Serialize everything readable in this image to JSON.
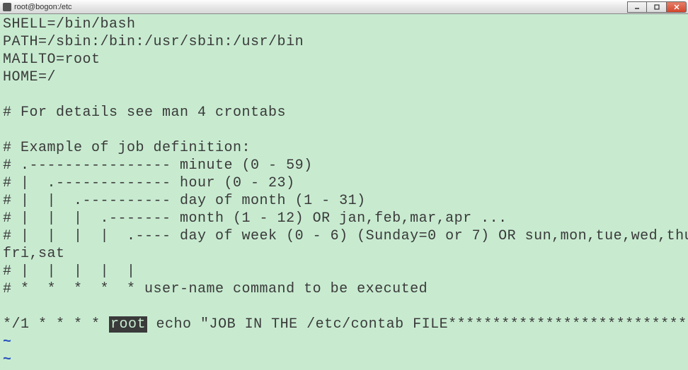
{
  "window": {
    "title": "root@bogon:/etc"
  },
  "terminal": {
    "lines": {
      "l0": "SHELL=/bin/bash",
      "l1": "PATH=/sbin:/bin:/usr/sbin:/usr/bin",
      "l2": "MAILTO=root",
      "l3": "HOME=/",
      "l4": "",
      "l5": "# For details see man 4 crontabs",
      "l6": "",
      "l7": "# Example of job definition:",
      "l8": "# .---------------- minute (0 - 59)",
      "l9": "# |  .------------- hour (0 - 23)",
      "l10": "# |  |  .---------- day of month (1 - 31)",
      "l11": "# |  |  |  .------- month (1 - 12) OR jan,feb,mar,apr ...",
      "l12": "# |  |  |  |  .---- day of week (0 - 6) (Sunday=0 or 7) OR sun,mon,tue,wed,thu,",
      "l13": "fri,sat",
      "l14": "# |  |  |  |  |",
      "l15": "# *  *  *  *  * user-name command to be executed",
      "l16": "",
      "l17_pre": "*/1 * * * * ",
      "l17_hl": "root",
      "l17_post": " echo \"JOB IN THE /etc/contab FILE***************************\"",
      "tilde1": "~",
      "tilde2": "~"
    }
  }
}
